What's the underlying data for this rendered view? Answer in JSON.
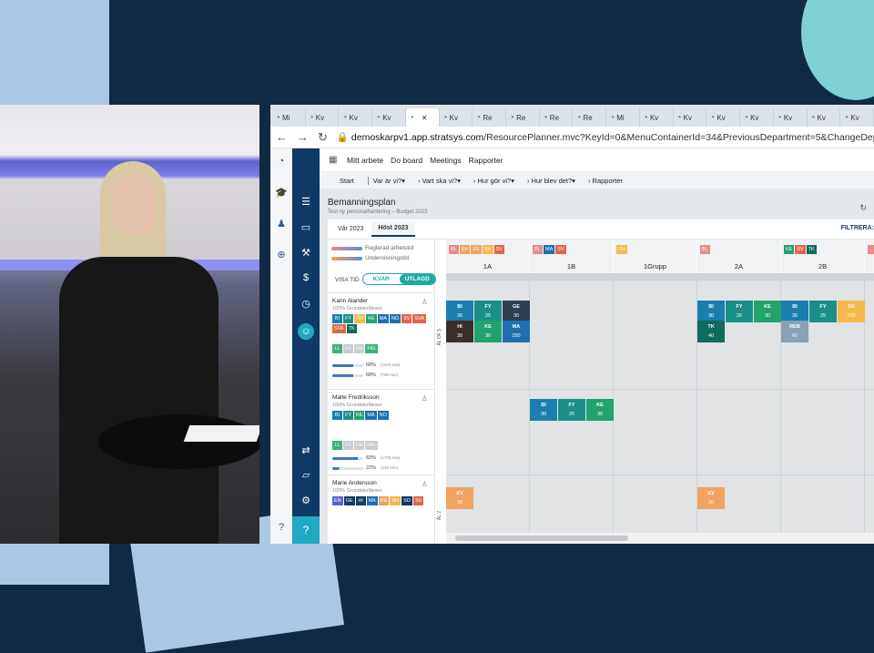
{
  "browser": {
    "tabs": [
      "Mi",
      "Kv",
      "Kv",
      "Kv",
      "",
      "Kv",
      "Re",
      "Re",
      "Re",
      "Re",
      "Mi",
      "Kv",
      "Kv",
      "Kv",
      "Kv",
      "Kv",
      "Kv",
      "Kv"
    ],
    "url_domain": "demoskarpv1.app.stratsys.com",
    "url_path": "/ResourcePlanner.mvc?KeyId=0&MenuContainerId=34&PreviousDepartment=5&ChangeDepartment=6"
  },
  "menu": {
    "items": [
      "Mitt arbete",
      "Do board",
      "Meetings",
      "Rapporter"
    ]
  },
  "submenu": {
    "items": [
      "Start",
      "Var är vi?",
      "Vart ska vi?",
      "Hur gör vi?",
      "Hur blev det?",
      "Rapporter"
    ]
  },
  "page": {
    "title": "Bemanningsplan",
    "subtitle": "Test ny personalhantering – Budget 2023",
    "filter_label": "FILTRERA:"
  },
  "period_tabs": [
    "Vår 2023",
    "Höst 2023"
  ],
  "legend": {
    "regulated": "Reglerad arbetstid",
    "teaching": "Undervisningstid"
  },
  "toggle": {
    "label": "VISA TID",
    "off": "KVAR",
    "on": "UTLAGD"
  },
  "classes": [
    {
      "name": "1A",
      "tags": [
        [
          "BL",
          "#e78b8b"
        ],
        [
          "EV",
          "#f0a35e"
        ],
        [
          "RE",
          "#f0a35e"
        ],
        [
          "SH",
          "#f5b84a"
        ],
        [
          "SV",
          "#e0664b"
        ]
      ]
    },
    {
      "name": "1B",
      "tags": [
        [
          "BL",
          "#e78b8b"
        ],
        [
          "MA",
          "#1f6fb0"
        ],
        [
          "SV",
          "#e0664b"
        ]
      ]
    },
    {
      "name": "1Grupp",
      "tags": [
        [
          "OH",
          "#f5b84a"
        ]
      ]
    },
    {
      "name": "2A",
      "tags": [
        [
          "BL",
          "#e78b8b"
        ]
      ]
    },
    {
      "name": "2B",
      "tags": [
        [
          "KE",
          "#22a36b"
        ],
        [
          "SV",
          "#e0664b"
        ],
        [
          "TK",
          "#0e6b5e"
        ]
      ]
    }
  ],
  "people": [
    {
      "name": "Karin Alander",
      "role": "100% Grundskollärare",
      "subjects": [
        [
          "BI",
          "#1a7fb0"
        ],
        [
          "FY",
          "#1a8f8a"
        ],
        [
          "OH",
          "#f5b84a"
        ],
        [
          "KE",
          "#22a36b"
        ],
        [
          "MA",
          "#1f6fb0"
        ],
        [
          "NO",
          "#1f6fb0"
        ],
        [
          "SV",
          "#e0664b"
        ],
        [
          "SVA",
          "#e0664b"
        ],
        [
          "SVA",
          "#e0664b"
        ],
        [
          "TK",
          "#0e6b5e"
        ]
      ],
      "extra": [
        [
          "LL",
          "#3bb37a"
        ],
        [
          "LF",
          "#c9ccd0"
        ],
        [
          "FH",
          "#c9ccd0"
        ],
        [
          "FKL",
          "#3bb37a"
        ]
      ],
      "pct1": "68%",
      "min1": "(1425 min)",
      "pct2": "68%",
      "min2": "(765 min)",
      "side": "ÅL OF 5"
    },
    {
      "name": "Malte Fredriksson",
      "role": "100% Grundskollärare",
      "subjects": [
        [
          "BI",
          "#1a7fb0"
        ],
        [
          "FY",
          "#1a8f8a"
        ],
        [
          "KE",
          "#22a36b"
        ],
        [
          "MA",
          "#1f6fb0"
        ],
        [
          "NO",
          "#1f6fb0"
        ]
      ],
      "extra": [
        [
          "LL",
          "#3bb37a"
        ],
        [
          "LF",
          "#c9ccd0"
        ],
        [
          "FH",
          "#c9ccd0"
        ],
        [
          "FKL",
          "#c9ccd0"
        ]
      ],
      "pct1": "83%",
      "min1": "(1745 min)",
      "pct2": "22%",
      "min2": "(245 min)",
      "side": ""
    },
    {
      "name": "Marie Andersson",
      "role": "100% Grundskollärare",
      "subjects": [
        [
          "EN",
          "#5a67c8"
        ],
        [
          "GE",
          "#0f3a66"
        ],
        [
          "HI",
          "#0f3a66"
        ],
        [
          "MA",
          "#1f6fb0"
        ],
        [
          "RE",
          "#f0a35e"
        ],
        [
          "SH",
          "#f5b84a"
        ],
        [
          "SO",
          "#0f3a66"
        ],
        [
          "SV",
          "#e0664b"
        ]
      ],
      "extra": [],
      "pct1": "",
      "min1": "",
      "pct2": "",
      "min2": "",
      "side": "ÅL 2"
    }
  ],
  "cells": [
    {
      "s": "BI",
      "v": "30",
      "c": "#1a7fb0",
      "col": 0,
      "slot": 0,
      "row": 0
    },
    {
      "s": "FY",
      "v": "25",
      "c": "#1a8f8a",
      "col": 0,
      "slot": 1,
      "row": 0
    },
    {
      "s": "GE",
      "v": "30",
      "c": "#2f3e52",
      "col": 0,
      "slot": 2,
      "row": 0
    },
    {
      "s": "HI",
      "v": "30",
      "c": "#3b2d2a",
      "col": 0,
      "slot": 0,
      "row": 1
    },
    {
      "s": "KE",
      "v": "30",
      "c": "#22a36b",
      "col": 0,
      "slot": 1,
      "row": 1
    },
    {
      "s": "MA",
      "v": "250",
      "c": "#1f6fb0",
      "col": 0,
      "slot": 2,
      "row": 1
    },
    {
      "s": "BI",
      "v": "30",
      "c": "#1a7fb0",
      "col": 3,
      "slot": 0,
      "row": 0
    },
    {
      "s": "FY",
      "v": "25",
      "c": "#1a8f8a",
      "col": 3,
      "slot": 1,
      "row": 0
    },
    {
      "s": "KE",
      "v": "30",
      "c": "#22a36b",
      "col": 3,
      "slot": 2,
      "row": 0
    },
    {
      "s": "TK",
      "v": "40",
      "c": "#0e6b5e",
      "col": 3,
      "slot": 0,
      "row": 1
    },
    {
      "s": "BI",
      "v": "30",
      "c": "#1a7fb0",
      "col": 4,
      "slot": 0,
      "row": 0
    },
    {
      "s": "FY",
      "v": "25",
      "c": "#1a8f8a",
      "col": 4,
      "slot": 1,
      "row": 0
    },
    {
      "s": "SH",
      "v": "100",
      "c": "#f5b84a",
      "col": 4,
      "slot": 2,
      "row": 0
    },
    {
      "s": "REB",
      "v": "60",
      "c": "#8aa0b4",
      "col": 4,
      "slot": 0,
      "row": 1
    },
    {
      "s": "BI",
      "v": "30",
      "c": "#1a7fb0",
      "col": 1,
      "slot": 0,
      "row": 2
    },
    {
      "s": "FY",
      "v": "25",
      "c": "#1a8f8a",
      "col": 1,
      "slot": 1,
      "row": 2
    },
    {
      "s": "KE",
      "v": "30",
      "c": "#22a36b",
      "col": 1,
      "slot": 2,
      "row": 2
    },
    {
      "s": "EV",
      "v": "30",
      "c": "#f0a35e",
      "col": 0,
      "slot": 0,
      "row": 3
    },
    {
      "s": "EV",
      "v": "30",
      "c": "#f0a35e",
      "col": 3,
      "slot": 0,
      "row": 3
    }
  ]
}
